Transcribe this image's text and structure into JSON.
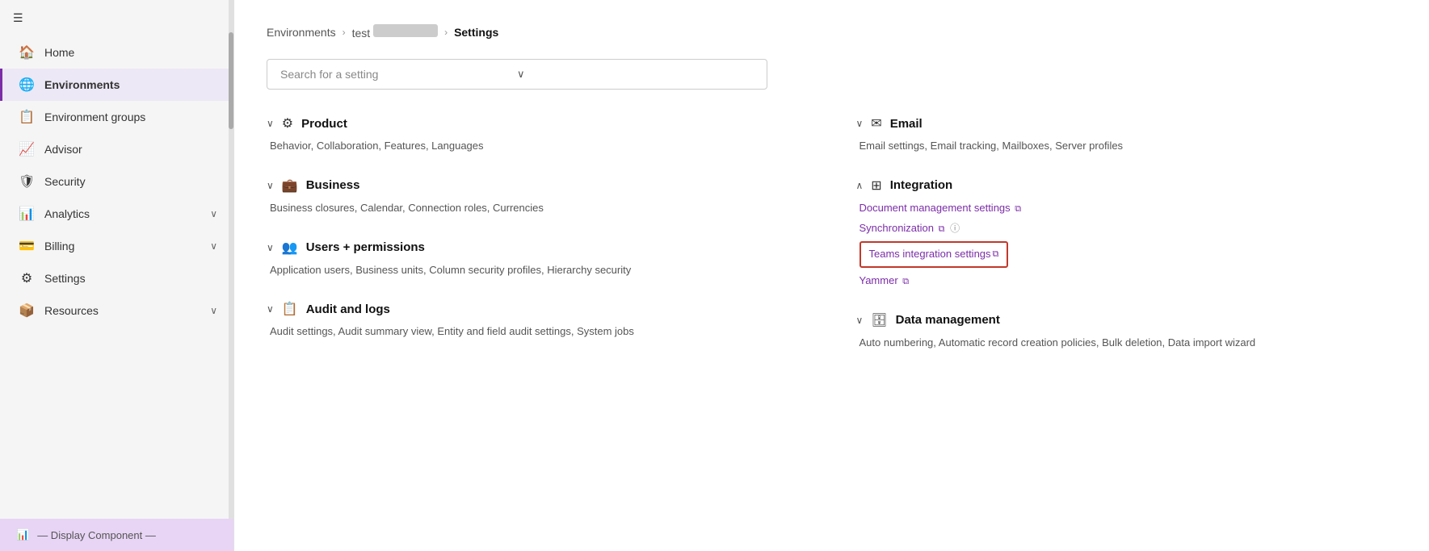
{
  "sidebar": {
    "hamburger_icon": "☰",
    "items": [
      {
        "id": "home",
        "label": "Home",
        "icon": "🏠",
        "active": false,
        "hasChevron": false
      },
      {
        "id": "environments",
        "label": "Environments",
        "icon": "🌐",
        "active": true,
        "hasChevron": false
      },
      {
        "id": "environment-groups",
        "label": "Environment groups",
        "icon": "📋",
        "active": false,
        "hasChevron": false
      },
      {
        "id": "advisor",
        "label": "Advisor",
        "icon": "📈",
        "active": false,
        "hasChevron": false
      },
      {
        "id": "security",
        "label": "Security",
        "icon": "🛡",
        "active": false,
        "hasChevron": false
      },
      {
        "id": "analytics",
        "label": "Analytics",
        "icon": "📊",
        "active": false,
        "hasChevron": true
      },
      {
        "id": "billing",
        "label": "Billing",
        "icon": "💳",
        "active": false,
        "hasChevron": true
      },
      {
        "id": "settings",
        "label": "Settings",
        "icon": "⚙",
        "active": false,
        "hasChevron": false
      },
      {
        "id": "resources",
        "label": "Resources",
        "icon": "📦",
        "active": false,
        "hasChevron": true
      }
    ],
    "bottom_label": "— Display Component —"
  },
  "breadcrumb": {
    "environments": "Environments",
    "sep1": "›",
    "env_name": "test",
    "sep2": "›",
    "current": "Settings"
  },
  "search": {
    "placeholder": "Search for a setting"
  },
  "left_sections": [
    {
      "id": "product",
      "title": "Product",
      "icon": "⚙",
      "links_text": "Behavior, Collaboration, Features, Languages"
    },
    {
      "id": "business",
      "title": "Business",
      "icon": "💼",
      "links_text": "Business closures, Calendar, Connection roles, Currencies"
    },
    {
      "id": "users-permissions",
      "title": "Users + permissions",
      "icon": "👥",
      "links_text": "Application users, Business units, Column security profiles, Hierarchy security"
    },
    {
      "id": "audit-logs",
      "title": "Audit and logs",
      "icon": "📋",
      "links_text": "Audit settings, Audit summary view, Entity and field audit settings, System jobs"
    }
  ],
  "right_sections": [
    {
      "id": "email",
      "title": "Email",
      "icon": "✉",
      "links_text": "Email settings, Email tracking, Mailboxes, Server profiles"
    },
    {
      "id": "integration",
      "title": "Integration",
      "icon": "⊞",
      "has_links": true,
      "links": [
        {
          "id": "doc-mgmt",
          "label": "Document management settings",
          "ext": true,
          "info": false,
          "highlighted": false
        },
        {
          "id": "sync",
          "label": "Synchronization",
          "ext": true,
          "info": true,
          "highlighted": false
        },
        {
          "id": "teams",
          "label": "Teams integration settings",
          "ext": true,
          "info": false,
          "highlighted": true
        },
        {
          "id": "yammer",
          "label": "Yammer",
          "ext": true,
          "info": false,
          "highlighted": false
        }
      ]
    },
    {
      "id": "data-management",
      "title": "Data management",
      "icon": "🗄",
      "links_text": "Auto numbering, Automatic record creation policies, Bulk deletion, Data import wizard"
    }
  ],
  "icons": {
    "collapse": "∨",
    "expand": "∧",
    "external": "⧉",
    "info": "ⓘ",
    "chevron_down": "∨",
    "search_chevron": "∨"
  }
}
